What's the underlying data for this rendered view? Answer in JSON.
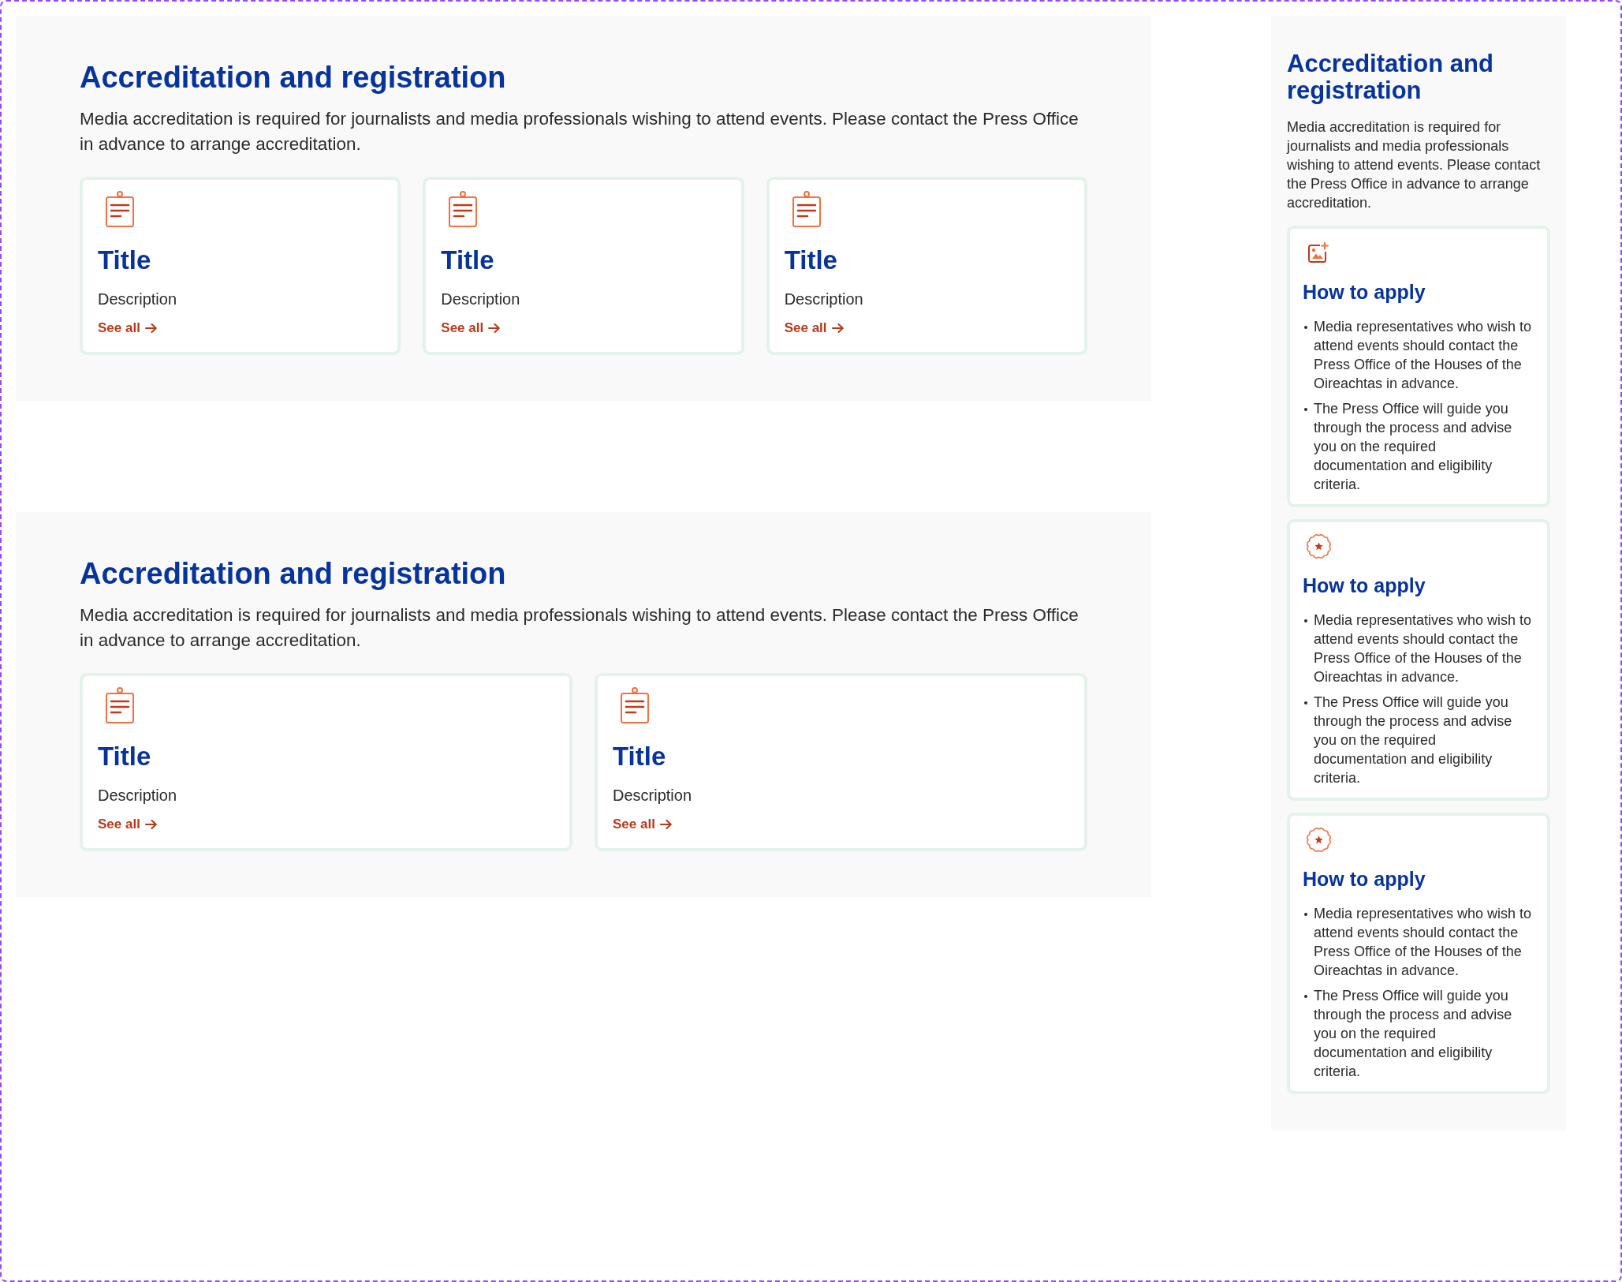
{
  "sections": [
    {
      "heading": "Accreditation and registration",
      "text": "Media accreditation is required for journalists and media professionals wishing to attend events. Please contact the Press Office in advance to arrange accreditation.",
      "cards": [
        {
          "title": "Title",
          "description": "Description",
          "link": "See all"
        },
        {
          "title": "Title",
          "description": "Description",
          "link": "See all"
        },
        {
          "title": "Title",
          "description": "Description",
          "link": "See all"
        }
      ]
    },
    {
      "heading": "Accreditation and registration",
      "text": "Media accreditation is required for journalists and media professionals wishing to attend events. Please contact the Press Office in advance to arrange accreditation.",
      "cards": [
        {
          "title": "Title",
          "description": "Description",
          "link": "See all"
        },
        {
          "title": "Title",
          "description": "Description",
          "link": "See all"
        }
      ]
    }
  ],
  "sidebar": {
    "heading": "Accreditation and registration",
    "text": "Media accreditation is required for journalists and media professionals wishing to attend events. Please contact the Press Office in advance to arrange accreditation.",
    "cards": [
      {
        "kind": "image",
        "title": "How to apply",
        "bullets": [
          "Media representatives who wish to attend events should contact the Press Office of the Houses of the Oireachtas in advance.",
          "The Press Office will guide you through the process and advise you on the required documentation and eligibility criteria."
        ]
      },
      {
        "kind": "badge",
        "title": "How to apply",
        "bullets": [
          "Media representatives who wish to attend events should contact the Press Office of the Houses of the Oireachtas in advance.",
          "The Press Office will guide you through the process and advise you on the required documentation and eligibility criteria."
        ]
      },
      {
        "kind": "badge",
        "title": "How to apply",
        "bullets": [
          "Media representatives who wish to attend events should contact the Press Office of the Houses of the Oireachtas in advance.",
          "The Press Office will guide you through the process and advise you on the required documentation and eligibility criteria."
        ]
      }
    ]
  }
}
